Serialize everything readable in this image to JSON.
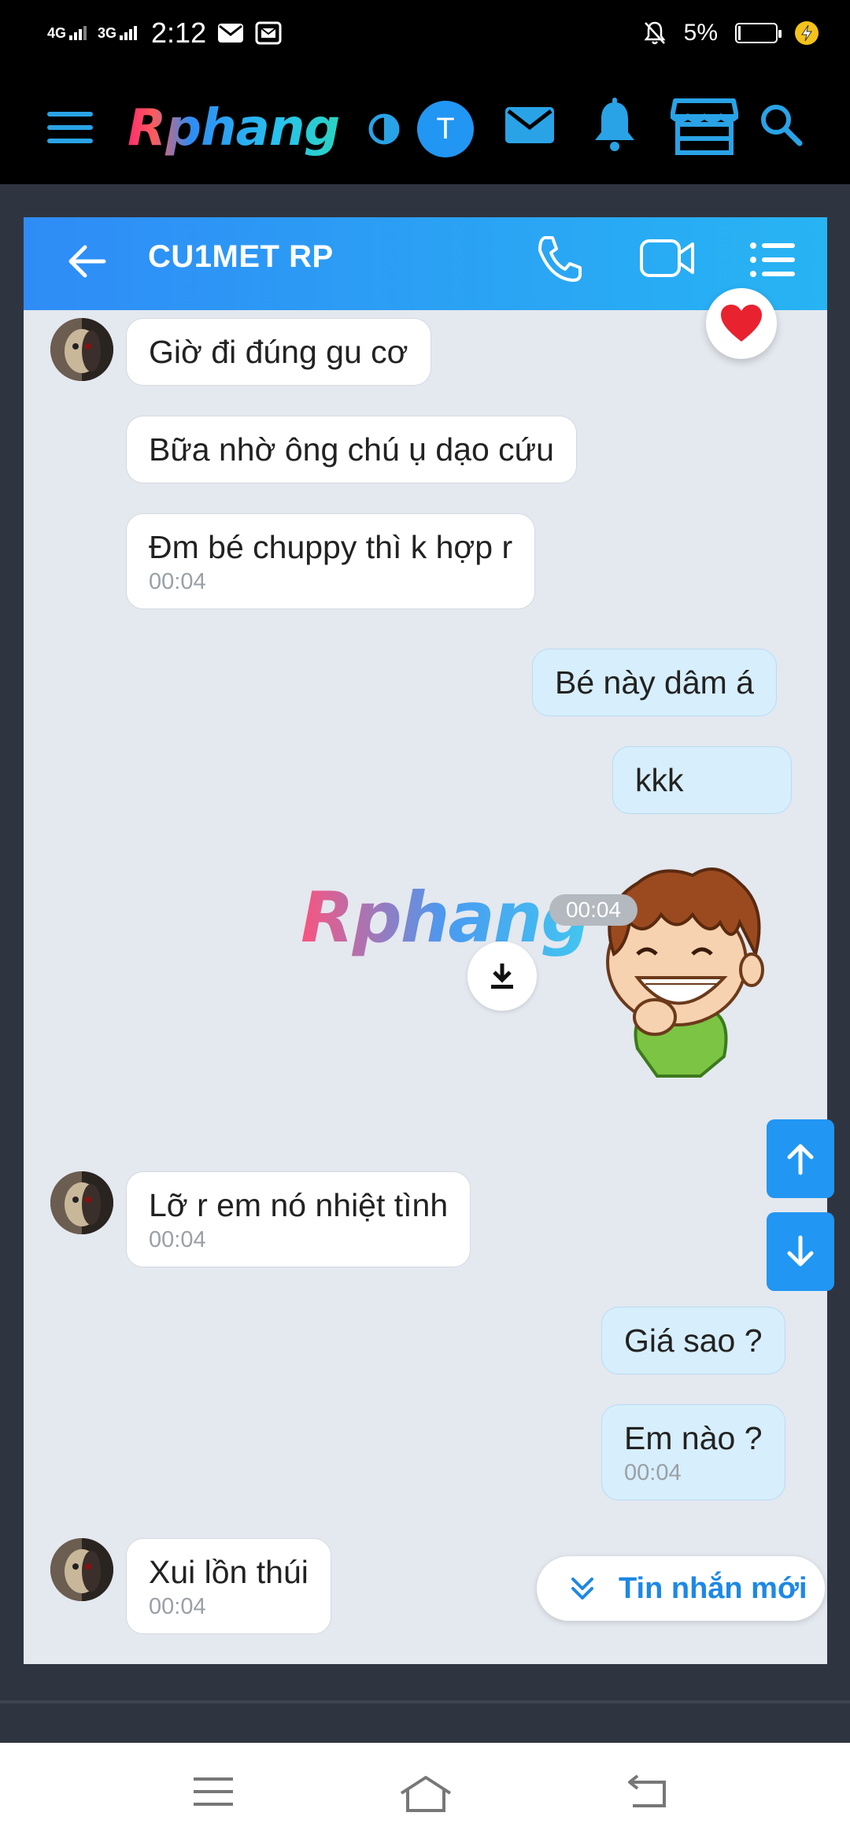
{
  "statusbar": {
    "net1": "4G",
    "net2": "3G",
    "time": "2:12",
    "battery": "5%"
  },
  "appbar": {
    "brand": "Rphang",
    "avatar_letter": "T",
    "icons": [
      "menu-icon",
      "contrast-icon",
      "mail-icon",
      "bell-icon",
      "store-icon",
      "search-icon"
    ],
    "accent": "#29a3e6"
  },
  "chat": {
    "title": "CU1MET RP",
    "header_icons": [
      "back-arrow-icon",
      "phone-icon",
      "video-icon",
      "list-icon"
    ],
    "messages": [
      {
        "text": "Giờ đi đúng gu cơ"
      },
      {
        "text": "Bữa nhờ ông chú ụ dạo cứu"
      },
      {
        "text": "Đm bé chuppy thì k hợp r",
        "time": "00:04"
      },
      {
        "text": "Bé này dâm á"
      },
      {
        "text": "kkk"
      },
      {
        "sticker": "boy-laughing-sticker",
        "watermark": "Rphang",
        "time": "00:04"
      },
      {
        "text": "Lỡ r em nó nhiệt tình",
        "time": "00:04"
      },
      {
        "text": "Giá sao ?"
      },
      {
        "text": "Em nào ?",
        "time": "00:04"
      },
      {
        "text": "Xui lồn thúi",
        "time": "00:04"
      }
    ],
    "new_messages_label": "Tin nhắn mới"
  },
  "colors": {
    "header_gradient_start": "#2f8cf6",
    "header_gradient_end": "#27b4f3",
    "my_bubble": "#d7eefc",
    "their_bubble": "#ffffff",
    "scroll_button": "#2196f3"
  }
}
